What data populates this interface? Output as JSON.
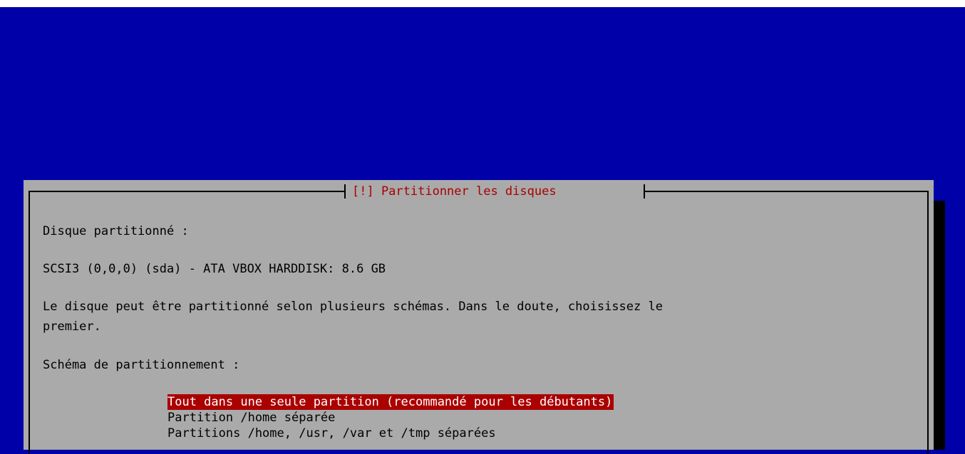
{
  "dialog": {
    "title": "[!] Partitionner les disques",
    "disk_label": "Disque partitionné :",
    "disk_name": "SCSI3 (0,0,0) (sda) - ATA VBOX HARDDISK: 8.6 GB",
    "description_line1": "Le disque peut être partitionné selon plusieurs schémas. Dans le doute, choisissez le",
    "description_line2": "premier.",
    "scheme_label": "Schéma de partitionnement :",
    "options": [
      {
        "label": "Tout dans une seule partition (recommandé pour les débutants)",
        "selected": true
      },
      {
        "label": "Partition /home séparée",
        "selected": false
      },
      {
        "label": "Partitions /home, /usr, /var et /tmp séparées",
        "selected": false
      }
    ]
  },
  "colors": {
    "background": "#0000a8",
    "dialog": "#aaaaaa",
    "title_text": "#aa0000",
    "selection_bg": "#aa0000",
    "selection_text": "#ffffff"
  }
}
